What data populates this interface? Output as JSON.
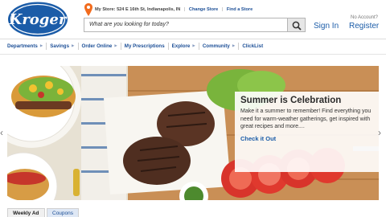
{
  "brand": {
    "logo_text": "Kroger",
    "color": "#1b5ca8"
  },
  "store_bar": {
    "label": "My Store:",
    "address": "524 E 16th St, Indianapolis, IN",
    "change_store": "Change Store",
    "find_store": "Find a Store"
  },
  "search": {
    "placeholder": "What are you looking for today?",
    "icon": "search-icon"
  },
  "account": {
    "sign_in": "Sign In",
    "no_account": "No Account?",
    "register": "Register"
  },
  "nav": {
    "items": [
      {
        "label": "Departments",
        "caret": "▶"
      },
      {
        "label": "Savings",
        "caret": "▶"
      },
      {
        "label": "Order Online",
        "caret": "▶"
      },
      {
        "label": "My Prescriptions",
        "caret": ""
      },
      {
        "label": "Explore",
        "caret": "▶"
      },
      {
        "label": "Community",
        "caret": "▶"
      },
      {
        "label": "ClickList",
        "caret": ""
      }
    ]
  },
  "hero": {
    "title": "Summer is Celebration",
    "body": "Make it a summer to remember! Find everything you need for warm-weather gatherings, get inspired with great recipes and more....",
    "cta": "Check it Out",
    "prev_icon": "‹",
    "next_icon": "›"
  },
  "tabs": {
    "weekly_ad": "Weekly Ad",
    "coupons": "Coupons"
  }
}
